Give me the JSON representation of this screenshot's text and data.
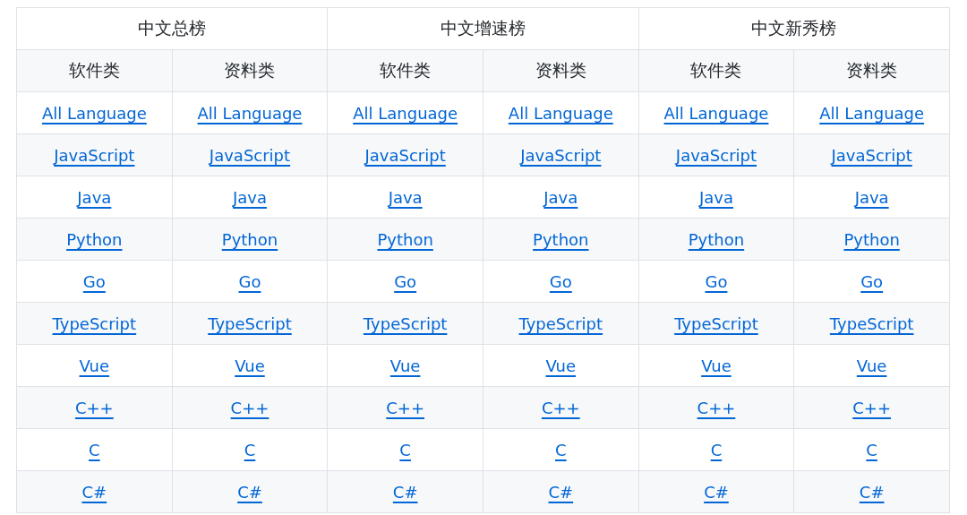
{
  "table": {
    "groups": [
      {
        "title": "中文总榜",
        "columns": [
          "软件类",
          "资料类"
        ]
      },
      {
        "title": "中文增速榜",
        "columns": [
          "软件类",
          "资料类"
        ]
      },
      {
        "title": "中文新秀榜",
        "columns": [
          "软件类",
          "资料类"
        ]
      }
    ],
    "rows": [
      {
        "cells": [
          "All Language",
          "All Language",
          "All Language",
          "All Language",
          "All Language",
          "All Language"
        ]
      },
      {
        "cells": [
          "JavaScript",
          "JavaScript",
          "JavaScript",
          "JavaScript",
          "JavaScript",
          "JavaScript"
        ]
      },
      {
        "cells": [
          "Java",
          "Java",
          "Java",
          "Java",
          "Java",
          "Java"
        ]
      },
      {
        "cells": [
          "Python",
          "Python",
          "Python",
          "Python",
          "Python",
          "Python"
        ]
      },
      {
        "cells": [
          "Go",
          "Go",
          "Go",
          "Go",
          "Go",
          "Go"
        ]
      },
      {
        "cells": [
          "TypeScript",
          "TypeScript",
          "TypeScript",
          "TypeScript",
          "TypeScript",
          "TypeScript"
        ]
      },
      {
        "cells": [
          "Vue",
          "Vue",
          "Vue",
          "Vue",
          "Vue",
          "Vue"
        ]
      },
      {
        "cells": [
          "C++",
          "C++",
          "C++",
          "C++",
          "C++",
          "C++"
        ]
      },
      {
        "cells": [
          "C",
          "C",
          "C",
          "C",
          "C",
          "C"
        ]
      },
      {
        "cells": [
          "C#",
          "C#",
          "C#",
          "C#",
          "C#",
          "C#"
        ]
      }
    ]
  }
}
